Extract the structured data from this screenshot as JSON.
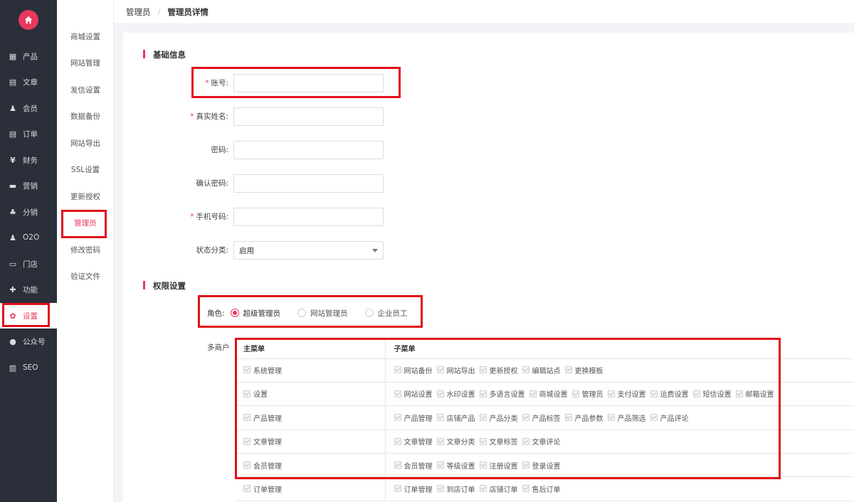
{
  "sidebar": {
    "items": [
      {
        "label": "产品",
        "icon": "grid-icon"
      },
      {
        "label": "文章",
        "icon": "document-icon"
      },
      {
        "label": "会员",
        "icon": "user-icon"
      },
      {
        "label": "订单",
        "icon": "order-icon"
      },
      {
        "label": "财务",
        "icon": "yen-icon"
      },
      {
        "label": "营销",
        "icon": "gift-icon"
      },
      {
        "label": "分销",
        "icon": "sitemap-icon"
      },
      {
        "label": "O2O",
        "icon": "user-icon"
      },
      {
        "label": "门店",
        "icon": "store-icon"
      },
      {
        "label": "功能",
        "icon": "puzzle-icon"
      },
      {
        "label": "设置",
        "icon": "gear-icon",
        "active": true
      },
      {
        "label": "公众号",
        "icon": "wechat-icon"
      },
      {
        "label": "SEO",
        "icon": "file-icon"
      }
    ]
  },
  "subnav": {
    "items": [
      "商城设置",
      "网站管理",
      "发信设置",
      "数据备份",
      "网站导出",
      "SSL设置",
      "更新授权",
      "管理员",
      "修改密码",
      "验证文件"
    ],
    "active_index": 7
  },
  "breadcrumb": {
    "parent": "管理员",
    "separator": "/",
    "current": "管理员详情"
  },
  "basic": {
    "title": "基础信息",
    "fields": [
      {
        "label": "账号:",
        "required": true,
        "value": ""
      },
      {
        "label": "真实姓名:",
        "required": true,
        "value": ""
      },
      {
        "label": "密码:",
        "required": false,
        "value": ""
      },
      {
        "label": "确认密码:",
        "required": false,
        "value": ""
      },
      {
        "label": "手机号码:",
        "required": true,
        "value": ""
      }
    ],
    "status": {
      "label": "状态分类:",
      "value": "启用"
    }
  },
  "perm": {
    "title": "权限设置",
    "role_label": "角色:",
    "roles": [
      {
        "label": "超级管理员",
        "checked": true
      },
      {
        "label": "网站管理员",
        "checked": false
      },
      {
        "label": "企业员工",
        "checked": false
      }
    ],
    "multi_label": "多商户",
    "headers": {
      "main": "主菜单",
      "sub": "子菜单"
    },
    "rows": [
      {
        "main": "系统管理",
        "subs": [
          "网站备份",
          "网站导出",
          "更新授权",
          "编辑站点",
          "更换模板"
        ]
      },
      {
        "main": "设置",
        "subs": [
          "网站设置",
          "水印设置",
          "多语言设置",
          "商城设置",
          "管理员",
          "支付设置",
          "运费设置",
          "短信设置",
          "邮箱设置"
        ]
      },
      {
        "main": "产品管理",
        "subs": [
          "产品管理",
          "店铺产品",
          "产品分类",
          "产品标签",
          "产品参数",
          "产品筛选",
          "产品评论"
        ]
      },
      {
        "main": "文章管理",
        "subs": [
          "文章管理",
          "文章分类",
          "文章标签",
          "文章评论"
        ]
      },
      {
        "main": "会员管理",
        "subs": [
          "会员管理",
          "等级设置",
          "注册设置",
          "登录设置"
        ]
      },
      {
        "main": "订单管理",
        "subs": [
          "订单管理",
          "到店订单",
          "店铺订单",
          "售后订单"
        ]
      }
    ]
  },
  "colors": {
    "accent": "#e8385e",
    "highlight_box": "#e1101a",
    "sidebar_bg": "#2b2f3a"
  }
}
